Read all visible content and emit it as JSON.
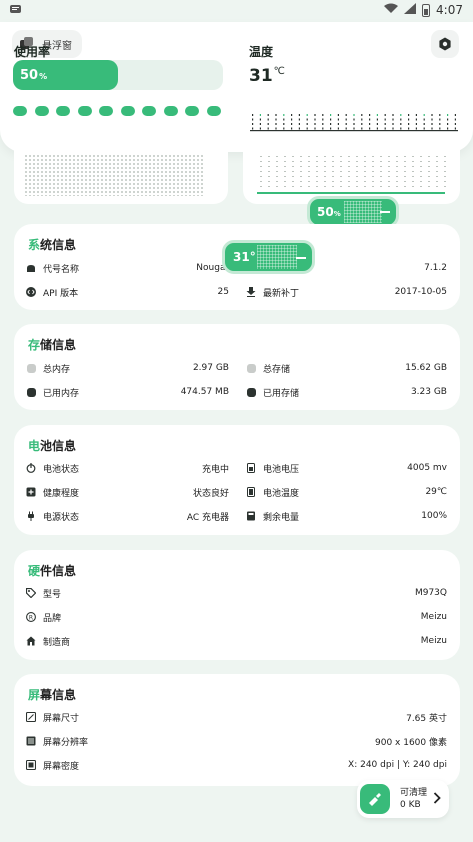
{
  "status_bar": {
    "time": "4:07"
  },
  "header": {
    "float_window_label": "悬浮窗",
    "usage_title": "使用率",
    "usage_value": "50",
    "usage_unit": "%",
    "usage_fraction": 0.5,
    "temp_title": "温度",
    "temp_value": "31",
    "temp_unit": "℃"
  },
  "bubbles": {
    "usage_value": "50",
    "usage_unit": "%",
    "temp_value": "31°"
  },
  "system": {
    "title_accent": "系",
    "title_rest": "统信息",
    "rows": [
      {
        "icon": "android-icon",
        "label": "代号名称",
        "value": "Nougat"
      },
      {
        "icon": "version-icon",
        "label": "",
        "value": "7.1.2"
      },
      {
        "icon": "code-icon",
        "label": "API 版本",
        "value": "25"
      },
      {
        "icon": "download-icon",
        "label": "最新补丁",
        "value": "2017-10-05"
      }
    ]
  },
  "storage": {
    "title_accent": "存",
    "title_rest": "储信息",
    "rows": [
      {
        "label": "总内存",
        "value": "2.97 GB",
        "color": "#c9ccca"
      },
      {
        "label": "总存储",
        "value": "15.62 GB",
        "color": "#c9ccca"
      },
      {
        "label": "已用内存",
        "value": "474.57 MB",
        "color": "#2c3330"
      },
      {
        "label": "已用存储",
        "value": "3.23 GB",
        "color": "#2c3330"
      }
    ]
  },
  "battery": {
    "title_accent": "电",
    "title_rest": "池信息",
    "rows": [
      {
        "icon": "power-icon",
        "label": "电池状态",
        "value": "充电中"
      },
      {
        "icon": "battery-icon",
        "label": "电池电压",
        "value": "4005 mv"
      },
      {
        "icon": "health-icon",
        "label": "健康程度",
        "value": "状态良好"
      },
      {
        "icon": "battery-icon",
        "label": "电池温度",
        "value": "29℃"
      },
      {
        "icon": "plug-icon",
        "label": "电源状态",
        "value": "AC 充电器"
      },
      {
        "icon": "battery-icon",
        "label": "剩余电量",
        "value": "100%"
      }
    ]
  },
  "hardware": {
    "title_accent": "硬",
    "title_rest": "件信息",
    "rows": [
      {
        "icon": "tag-icon",
        "label": "型号",
        "value": "M973Q"
      },
      {
        "icon": "brand-icon",
        "label": "品牌",
        "value": "Meizu"
      },
      {
        "icon": "home-icon",
        "label": "制造商",
        "value": "Meizu"
      }
    ]
  },
  "screen": {
    "title_accent": "屏",
    "title_rest": "幕信息",
    "rows": [
      {
        "icon": "screen-size-icon",
        "label": "屏幕尺寸",
        "value": "7.65 英寸"
      },
      {
        "icon": "resolution-icon",
        "label": "屏幕分辨率",
        "value": "900 x 1600 像素"
      },
      {
        "icon": "density-icon",
        "label": "屏幕密度",
        "value": "X: 240 dpi  |  Y: 240 dpi"
      }
    ]
  },
  "clean": {
    "label": "可清理",
    "size": "0 KB"
  },
  "colors": {
    "accent": "#38bb7a",
    "accent_light": "#c4e9d5",
    "background": "#eef5f1"
  }
}
